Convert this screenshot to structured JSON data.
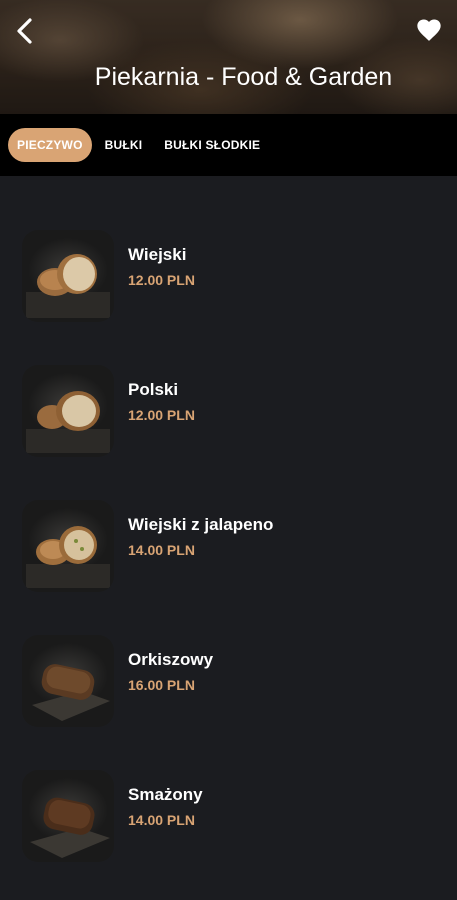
{
  "header": {
    "title": "Piekarnia - Food & Garden",
    "back_icon": "chevron-left-icon",
    "favorite_icon": "heart-icon"
  },
  "tabs": [
    {
      "label": "PIECZYWO",
      "active": true
    },
    {
      "label": "BUŁKI",
      "active": false
    },
    {
      "label": "BUŁKI SŁODKIE",
      "active": false
    }
  ],
  "products": [
    {
      "name": "Wiejski",
      "price": "12.00 PLN"
    },
    {
      "name": "Polski",
      "price": "12.00 PLN"
    },
    {
      "name": "Wiejski z jalapeno",
      "price": "14.00 PLN"
    },
    {
      "name": "Orkiszowy",
      "price": "16.00 PLN"
    },
    {
      "name": "Smażony",
      "price": "14.00 PLN"
    }
  ],
  "colors": {
    "accent": "#d9a474",
    "background": "#1b1c20",
    "tabbar": "#000000"
  }
}
